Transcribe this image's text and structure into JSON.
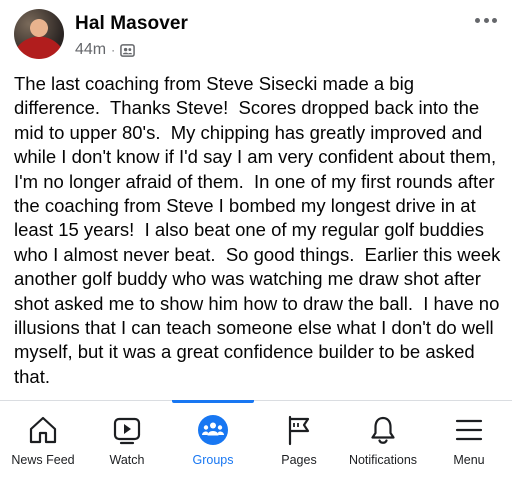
{
  "post": {
    "author": "Hal Masover",
    "timestamp": "44m",
    "separator": "·",
    "audience_icon": "group-audience-icon",
    "body": "The last coaching from Steve Sisecki made a big difference.  Thanks Steve!  Scores dropped back into the mid to upper 80's.  My chipping has greatly improved and while I don't know if I'd say I am very confident about them, I'm no longer afraid of them.  In one of my first rounds after the coaching from Steve I bombed my longest drive in at least 15 years!  I also beat one of my regular golf buddies who I almost never beat.  So good things.  Earlier this week another golf buddy who was watching me draw shot after shot asked me to show him how to draw the ball.  I have no illusions that I can teach someone else what I don't do well myself, but it was a great confidence builder to be asked that."
  },
  "nav": {
    "items": [
      {
        "label": "News Feed",
        "icon": "home-icon"
      },
      {
        "label": "Watch",
        "icon": "watch-icon"
      },
      {
        "label": "Groups",
        "icon": "groups-icon",
        "active": true
      },
      {
        "label": "Pages",
        "icon": "pages-flag-icon"
      },
      {
        "label": "Notifications",
        "icon": "bell-icon"
      },
      {
        "label": "Menu",
        "icon": "hamburger-icon"
      }
    ]
  },
  "colors": {
    "accent": "#1877f2",
    "text": "#050505",
    "secondary_text": "#65676b",
    "nav_icon": "#1c1e21"
  }
}
